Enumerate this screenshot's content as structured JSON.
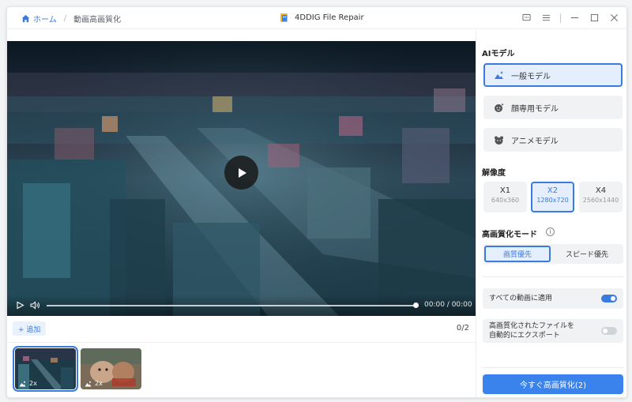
{
  "breadcrumb": {
    "home": "ホーム",
    "current": "動画高画質化"
  },
  "app": {
    "title": "4DDIG File Repair"
  },
  "player": {
    "time": "00:00 / 00:00"
  },
  "files": {
    "add_label": "+ 追加",
    "count": "0/2",
    "items": [
      {
        "badge": "2x"
      },
      {
        "badge": "2x"
      }
    ]
  },
  "panel": {
    "ai_model_title": "AIモデル",
    "models": [
      {
        "label": "一般モデル"
      },
      {
        "label": "顔専用モデル"
      },
      {
        "label": "アニメモデル"
      }
    ],
    "resolution_title": "解像度",
    "resolutions": [
      {
        "label": "X1",
        "size": "640x360"
      },
      {
        "label": "X2",
        "size": "1280x720"
      },
      {
        "label": "X4",
        "size": "2560x1440"
      }
    ],
    "mode_title": "高画質化モード",
    "modes": [
      {
        "label": "画質優先"
      },
      {
        "label": "スピード優先"
      }
    ],
    "apply_all": {
      "label": "すべての動画に適用",
      "on": true
    },
    "auto_export": {
      "label_line1": "高画質化されたファイルを",
      "label_line2": "自動的にエクスポート",
      "on": false
    },
    "start_button": "今すぐ高画質化(2)"
  },
  "colors": {
    "accent": "#3a7be0",
    "button": "#3a82ec"
  }
}
